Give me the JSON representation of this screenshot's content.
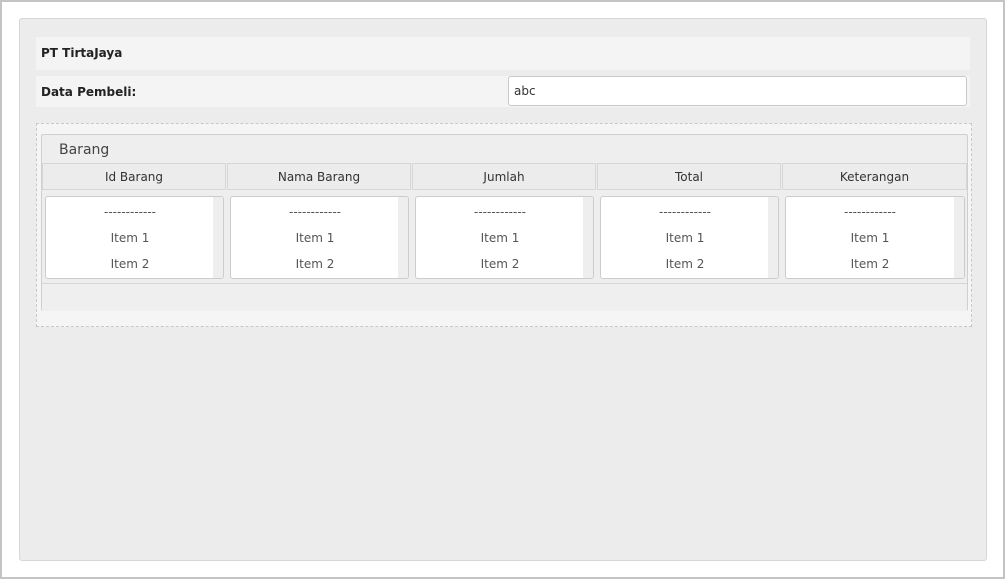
{
  "company": {
    "title": "PT TirtaJaya"
  },
  "buyer": {
    "label": "Data Pembeli:",
    "value": "abc"
  },
  "barang": {
    "legend": "Barang",
    "columns": [
      {
        "header": "Id Barang",
        "options": [
          "------------",
          "Item 1",
          "Item 2"
        ]
      },
      {
        "header": "Nama Barang",
        "options": [
          "------------",
          "Item 1",
          "Item 2"
        ]
      },
      {
        "header": "Jumlah",
        "options": [
          "------------",
          "Item 1",
          "Item 2"
        ]
      },
      {
        "header": "Total",
        "options": [
          "------------",
          "Item 1",
          "Item 2"
        ]
      },
      {
        "header": "Keterangan",
        "options": [
          "------------",
          "Item 1",
          "Item 2"
        ]
      }
    ]
  }
}
